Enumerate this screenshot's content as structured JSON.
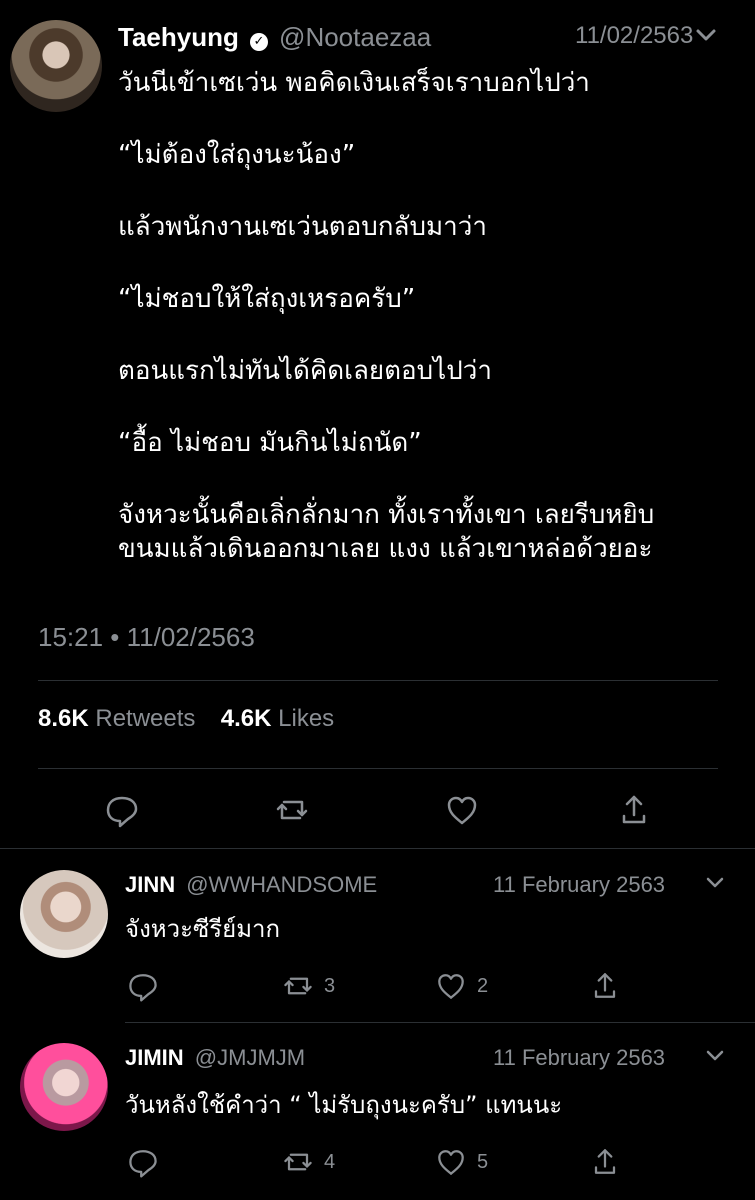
{
  "tweet": {
    "author_name": "Taehyung",
    "author_handle": "@Nootaezaa",
    "date_top": "11/02/2563",
    "lines": [
      "วันนีเข้าเซเว่น พอคิดเงินเสร็จเราบอกไปว่า",
      "“ไม่ต้องใส่ถุงนะน้อง”",
      "แล้วพนักงานเซเว่นตอบกลับมาว่า",
      " “ไม่ชอบให้ใส่ถุงเหรอครับ”",
      "ตอนแรกไม่ทันได้คิดเลยตอบไปว่า",
      "“อื้อ ไม่ชอบ มันกินไม่ถนัด”",
      "จังหวะนั้นคือเลิ่กลั่กมาก ทั้งเราทั้งเขา เลยรีบหยิบ",
      "ขนมแล้วเดินออกมาเลย แงง แล้วเขาหล่อด้วยอะ"
    ],
    "timestamp": "15:21 • 11/02/2563",
    "retweets_count": "8.6K",
    "retweets_label": "Retweets",
    "likes_count": "4.6K",
    "likes_label": "Likes"
  },
  "replies": [
    {
      "name": "JINN",
      "handle": "@WWHANDSOME",
      "date": "11 February 2563",
      "text": "จังหวะซีรีย์มาก",
      "retweets": "3",
      "likes": "2"
    },
    {
      "name": "JIMIN",
      "handle": "@JMJMJM",
      "date": "11 February 2563",
      "text": "วันหลังใช้คำว่า “ ไม่รับถุงนะครับ” แทนนะ",
      "retweets": "4",
      "likes": "5"
    }
  ],
  "icons": [
    "reply-icon",
    "retweet-icon",
    "like-icon",
    "share-icon",
    "chevron-down-icon",
    "verified-badge-icon"
  ],
  "colors": {
    "background": "#000000",
    "text": "#ffffff",
    "muted": "#8b8f94",
    "divider": "#2b2f33"
  }
}
